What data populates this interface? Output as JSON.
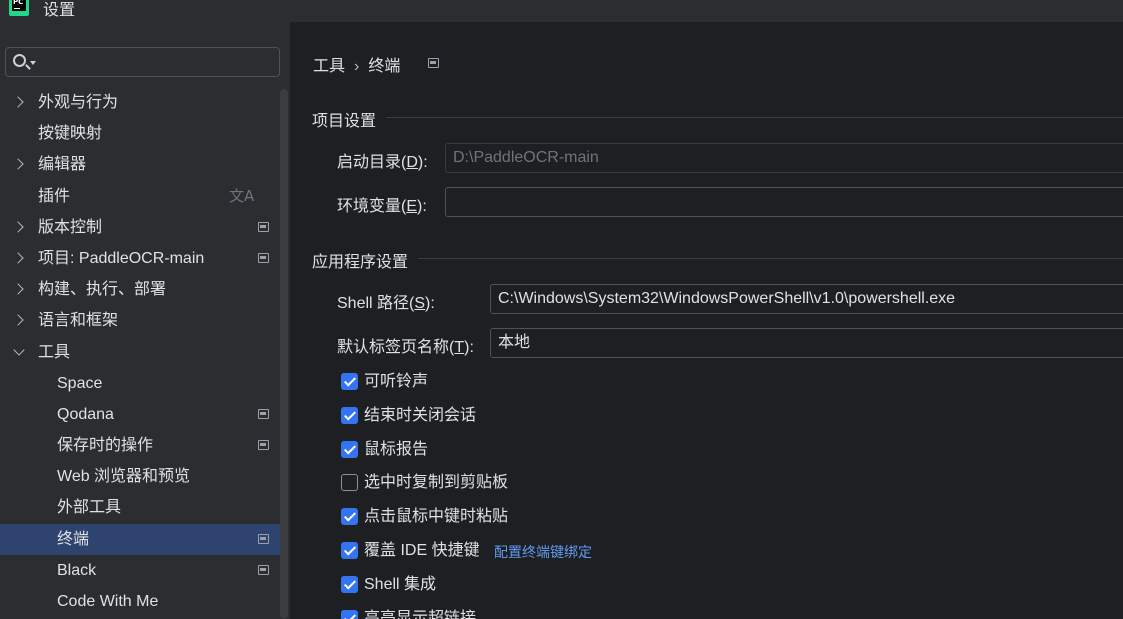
{
  "window": {
    "title": "设置",
    "app_icon_text": "PC"
  },
  "sidebar": {
    "search": {
      "value": ""
    },
    "items": [
      {
        "label": "外观与行为",
        "expander": "collapsed",
        "level": 0,
        "project_icon": false
      },
      {
        "label": "按键映射",
        "expander": "none",
        "level": 0,
        "project_icon": false
      },
      {
        "label": "编辑器",
        "expander": "collapsed",
        "level": 0,
        "project_icon": false
      },
      {
        "label": "插件",
        "expander": "none",
        "level": 0,
        "project_icon": false,
        "translate_icon": "文A"
      },
      {
        "label": "版本控制",
        "expander": "collapsed",
        "level": 0,
        "project_icon": true
      },
      {
        "label": "项目: PaddleOCR-main",
        "expander": "collapsed",
        "level": 0,
        "project_icon": true
      },
      {
        "label": "构建、执行、部署",
        "expander": "collapsed",
        "level": 0,
        "project_icon": false
      },
      {
        "label": "语言和框架",
        "expander": "collapsed",
        "level": 0,
        "project_icon": false
      },
      {
        "label": "工具",
        "expander": "expanded",
        "level": 0,
        "project_icon": false
      },
      {
        "label": "Space",
        "expander": "none",
        "level": 1,
        "project_icon": false
      },
      {
        "label": "Qodana",
        "expander": "none",
        "level": 1,
        "project_icon": true
      },
      {
        "label": "保存时的操作",
        "expander": "none",
        "level": 1,
        "project_icon": true
      },
      {
        "label": "Web 浏览器和预览",
        "expander": "none",
        "level": 1,
        "project_icon": false
      },
      {
        "label": "外部工具",
        "expander": "none",
        "level": 1,
        "project_icon": false
      },
      {
        "label": "终端",
        "expander": "none",
        "level": 1,
        "project_icon": true,
        "selected": true
      },
      {
        "label": "Black",
        "expander": "none",
        "level": 1,
        "project_icon": true
      },
      {
        "label": "Code With Me",
        "expander": "none",
        "level": 1,
        "project_icon": false
      }
    ]
  },
  "breadcrumb": {
    "parent": "工具",
    "separator": "›",
    "current": "终端"
  },
  "project_settings": {
    "title": "项目设置",
    "start_dir": {
      "label": "启动目录(",
      "mnemonic": "D",
      "label_end": "):",
      "value": "D:\\PaddleOCR-main"
    },
    "env_vars": {
      "label": "环境变量(",
      "mnemonic": "E",
      "label_end": "):",
      "value": ""
    }
  },
  "app_settings": {
    "title": "应用程序设置",
    "shell_path": {
      "label": "Shell 路径(",
      "mnemonic": "S",
      "label_end": "):",
      "value": "C:\\Windows\\System32\\WindowsPowerShell\\v1.0\\powershell.exe"
    },
    "tab_name": {
      "label": "默认标签页名称(",
      "mnemonic": "T",
      "label_end": "):",
      "value": "本地"
    },
    "checkboxes": [
      {
        "label": "可听铃声",
        "checked": true
      },
      {
        "label": "结束时关闭会话",
        "checked": true
      },
      {
        "label": "鼠标报告",
        "checked": true
      },
      {
        "label": "选中时复制到剪贴板",
        "checked": false
      },
      {
        "label": "点击鼠标中键时粘贴",
        "checked": true
      },
      {
        "label": "覆盖 IDE 快捷键",
        "checked": true,
        "link": "配置终端键绑定"
      },
      {
        "label": "Shell 集成",
        "checked": true
      },
      {
        "label": "高亮显示超链接",
        "checked": true
      }
    ]
  },
  "colors": {
    "accent": "#3574f0",
    "selection": "#2e436e",
    "link": "#5e9cf0"
  }
}
